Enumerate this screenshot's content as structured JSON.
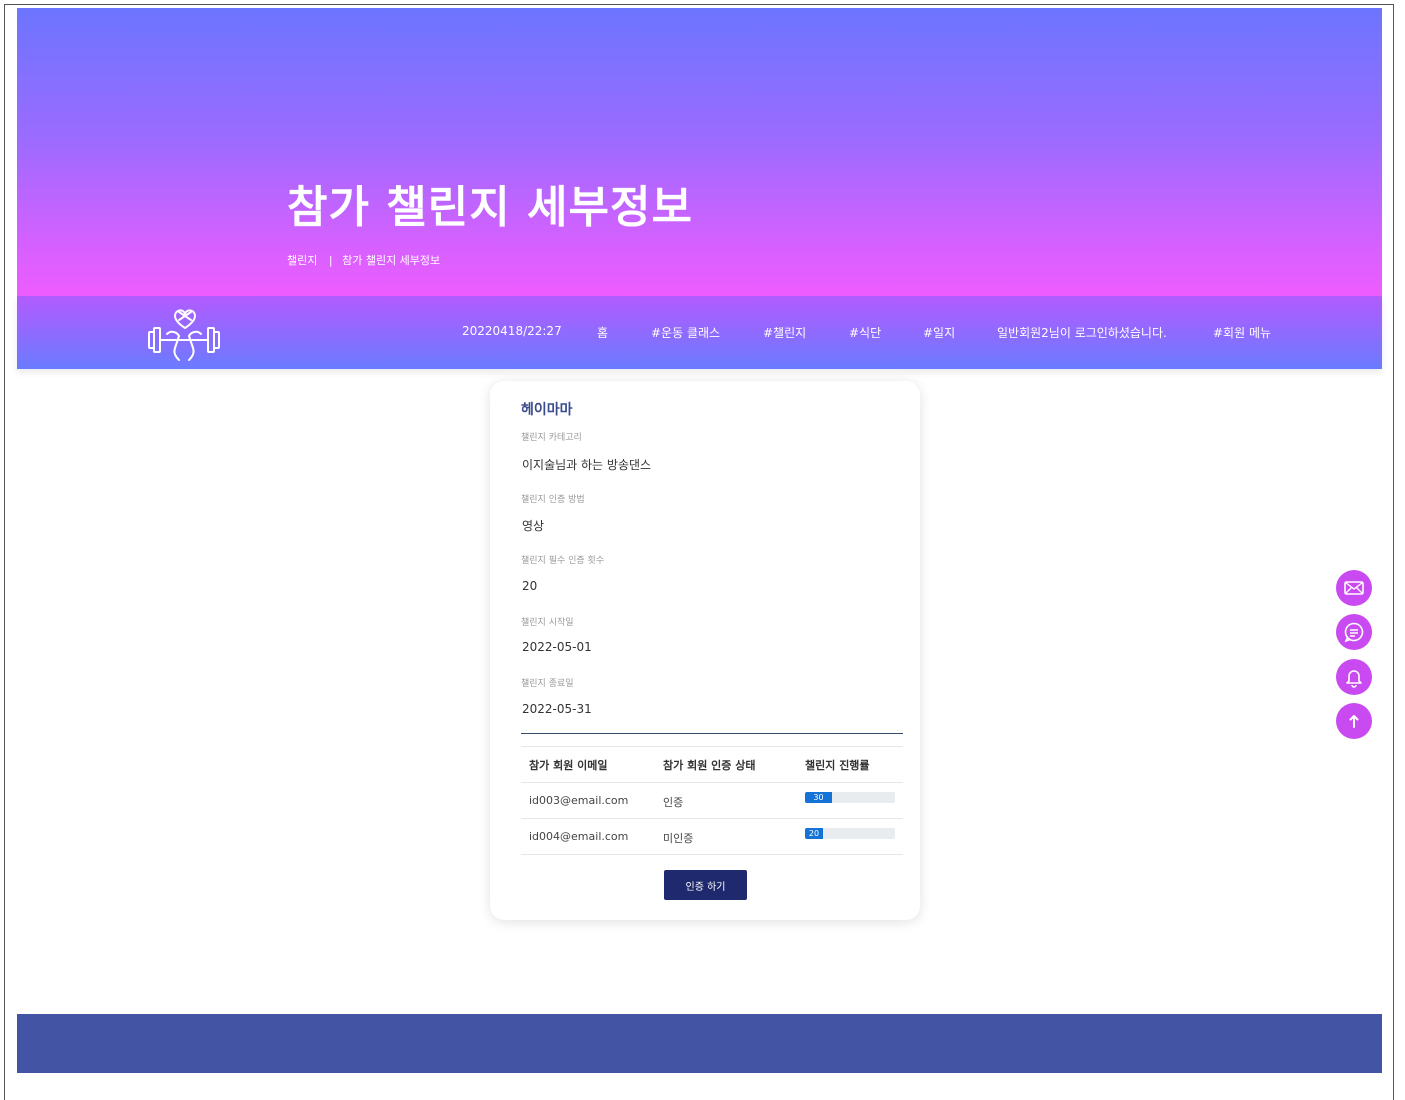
{
  "hero": {
    "title": "참가 챌린지 세부정보",
    "breadcrumb": [
      "챌린지",
      "|",
      "참가 챌린지 세부정보"
    ]
  },
  "nav": {
    "items": [
      {
        "label": "20220418/22:27"
      },
      {
        "label": "홈"
      },
      {
        "label": "#운동 클래스"
      },
      {
        "label": "#챌린지"
      },
      {
        "label": "#식단"
      },
      {
        "label": "#일지"
      },
      {
        "label": "일반회원2님이 로그인하셨습니다."
      },
      {
        "label": "#회원 메뉴"
      }
    ],
    "logo_icon": "heart-dumbbell-logo-icon"
  },
  "card": {
    "title": "헤이마마",
    "fields": [
      {
        "label": "챌린지 카테고리",
        "value": "이지술님과 하는 방송댄스"
      },
      {
        "label": "챌린지 인증 방법",
        "value": "영상"
      },
      {
        "label": "챌린지 필수 인증 횟수",
        "value": "20"
      },
      {
        "label": "챌린지 시작일",
        "value": "2022-05-01"
      },
      {
        "label": "챌린지 종료일",
        "value": "2022-05-31"
      }
    ],
    "table": {
      "headers": [
        "참가 회원 이메일",
        "참가 회원 인증 상태",
        "챌린지 진행률"
      ],
      "rows": [
        {
          "email": "id003@email.com",
          "status": "인증",
          "progress": 30,
          "progress_label": "30"
        },
        {
          "email": "id004@email.com",
          "status": "미인증",
          "progress": 20,
          "progress_label": "20"
        }
      ]
    },
    "auth_button": "인증 하기"
  },
  "float_buttons": [
    {
      "icon": "mail-icon"
    },
    {
      "icon": "chat-icon"
    },
    {
      "icon": "bell-icon"
    },
    {
      "icon": "arrow-up-icon"
    }
  ],
  "colors": {
    "accent": "#c94af0",
    "button": "#1f2a6e",
    "footer": "#4354a5",
    "progress": "#1572d6",
    "title": "#3a4c8c"
  }
}
